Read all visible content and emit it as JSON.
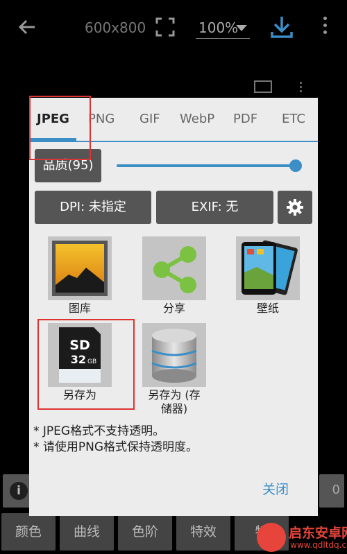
{
  "toolbar": {
    "image_size": "600x800",
    "zoom": "100%"
  },
  "bottom_bar": {
    "info": "i",
    "right_count": "0",
    "tabs": [
      "颜色",
      "曲线",
      "色阶",
      "特效",
      "特"
    ]
  },
  "dialog": {
    "format_tabs": [
      "JPEG",
      "PNG",
      "GIF",
      "WebP",
      "PDF",
      "ETC"
    ],
    "active_tab": "JPEG",
    "quality_label": "品质(95)",
    "quality_value": 95,
    "dpi_button": "DPI: 未指定",
    "exif_button": "EXIF: 无",
    "actions": [
      {
        "label": "图库",
        "icon": "gallery-icon"
      },
      {
        "label": "分享",
        "icon": "share-icon"
      },
      {
        "label": "壁纸",
        "icon": "wallpaper-icon"
      },
      {
        "label": "另存为",
        "icon": "sd-card-icon",
        "card_text": "SD",
        "card_capacity": "32",
        "card_unit": "GB"
      },
      {
        "label": "另存为 (存\n储器)",
        "icon": "storage-icon"
      }
    ],
    "notes": [
      "* JPEG格式不支持透明。",
      "* 请使用PNG格式保持透明度。"
    ],
    "close_label": "关闭"
  },
  "watermark": {
    "title": "启东安卓网",
    "url": "www.qdltdq.com"
  },
  "colors": {
    "accent": "#3b8ec6",
    "highlight": "#d33333",
    "dialog_bg": "#ececec"
  }
}
